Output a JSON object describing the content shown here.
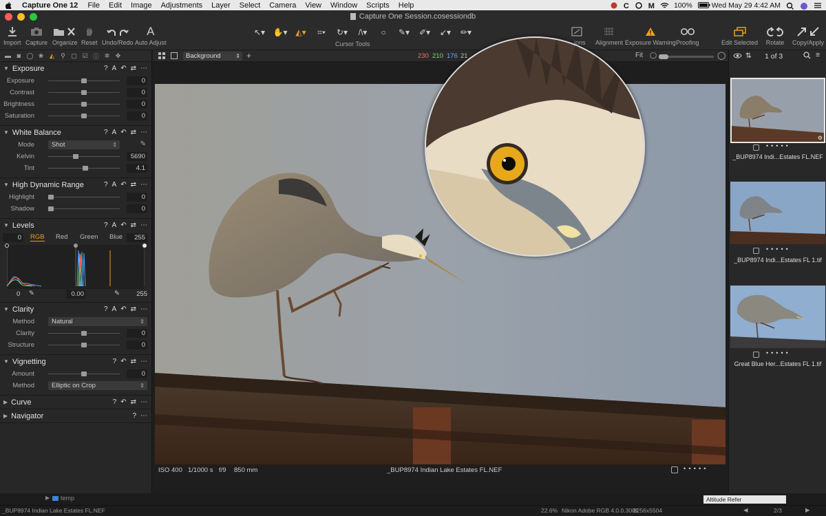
{
  "menubar": {
    "app_name": "Capture One 12",
    "items": [
      "File",
      "Edit",
      "Image",
      "Adjustments",
      "Layer",
      "Select",
      "Camera",
      "View",
      "Window",
      "Scripts",
      "Help"
    ],
    "battery": "100%",
    "datetime": "Wed May 29  4:42 AM"
  },
  "window": {
    "title": "Capture One Session.cosessiondb"
  },
  "toolbar": {
    "import": "Import",
    "capture": "Capture",
    "organize": "Organize",
    "reset": "Reset",
    "undo_redo": "Undo/Redo",
    "auto_adjust": "Auto Adjust",
    "cursor_tools": "Cursor Tools",
    "guides": "…ions",
    "alignment": "Alignment",
    "exposure_warning": "Exposure Warning",
    "proofing": "Proofing",
    "edit_selected": "Edit Selected",
    "rotate": "Rotate",
    "copy_apply": "Copy/Apply"
  },
  "exposure": {
    "title": "Exposure",
    "rows": [
      {
        "label": "Exposure",
        "value": "0",
        "level": 0.5
      },
      {
        "label": "Contrast",
        "value": "0",
        "level": 0.5
      },
      {
        "label": "Brightness",
        "value": "0",
        "level": 0.5
      },
      {
        "label": "Saturation",
        "value": "0",
        "level": 0.5
      }
    ]
  },
  "white_balance": {
    "title": "White Balance",
    "mode_label": "Mode",
    "mode_value": "Shot",
    "kelvin_label": "Kelvin",
    "kelvin_value": "5690",
    "kelvin_level": 0.38,
    "tint_label": "Tint",
    "tint_value": "4.1",
    "tint_level": 0.52
  },
  "hdr": {
    "title": "High Dynamic Range",
    "rows": [
      {
        "label": "Highlight",
        "value": "0",
        "level": 0.0
      },
      {
        "label": "Shadow",
        "value": "0",
        "level": 0.0
      }
    ]
  },
  "levels": {
    "title": "Levels",
    "low": "0",
    "high": "255",
    "tabs": [
      "RGB",
      "Red",
      "Green",
      "Blue"
    ],
    "foot_low": "0",
    "foot_mid": "0.00",
    "foot_high": "255"
  },
  "clarity": {
    "title": "Clarity",
    "method_label": "Method",
    "method_value": "Natural",
    "rows": [
      {
        "label": "Clarity",
        "value": "0",
        "level": 0.5
      },
      {
        "label": "Structure",
        "value": "0",
        "level": 0.5
      }
    ]
  },
  "vignetting": {
    "title": "Vignetting",
    "amount_label": "Amount",
    "amount_value": "0",
    "amount_level": 0.5,
    "method_label": "Method",
    "method_value": "Elliptic on Crop"
  },
  "curve": {
    "title": "Curve"
  },
  "navigator": {
    "title": "Navigator"
  },
  "viewer": {
    "layer": "Background",
    "readout_r": "230",
    "readout_g": "210",
    "readout_b": "176",
    "readout_extra": "21",
    "zoom": "Fit",
    "iso": "ISO 400",
    "shutter": "1/1000 s",
    "aperture": "f/9",
    "focal": "850 mm",
    "filename": "_BUP8974  Indian Lake Estates FL.NEF"
  },
  "browser": {
    "count": "1 of 3",
    "thumbs": [
      {
        "name": "_BUP8974  Indi...Estates FL.NEF"
      },
      {
        "name": "_BUP8974  Indi...Estates FL 1.tif"
      },
      {
        "name": "Great Blue Her...Estates FL 1.tif"
      }
    ]
  },
  "bottom": {
    "folder": "temp",
    "left_file": "_BUP8974  Indian Lake Estates FL.NEF",
    "zoom_pct": "22.6%",
    "profile": "Nikon Adobe RGB 4.0.0.3001",
    "dims": "8256x5504",
    "page": "2/3",
    "right_label": "Altitude Refer"
  },
  "colors": {
    "accent": "#f39c1f",
    "panel": "#272727",
    "sky": "#8f9aa7"
  }
}
